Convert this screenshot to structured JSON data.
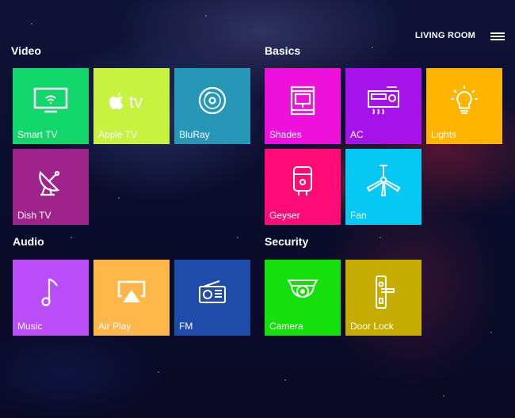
{
  "header": {
    "room_label": "LIVING ROOM",
    "menu_icon": "hamburger-menu-icon"
  },
  "sections": {
    "video": {
      "title": "Video",
      "tiles": [
        {
          "label": "Smart TV",
          "icon": "smart-tv-icon",
          "color": "#12d76a"
        },
        {
          "label": "Apple TV",
          "icon": "apple-tv-icon",
          "color": "#c7f23f"
        },
        {
          "label": "BluRay",
          "icon": "bluray-disc-icon",
          "color": "#2797b8"
        },
        {
          "label": "Dish TV",
          "icon": "satellite-dish-icon",
          "color": "#a0228b"
        }
      ]
    },
    "basics": {
      "title": "Basics",
      "tiles": [
        {
          "label": "Shades",
          "icon": "window-shades-icon",
          "color": "#ee11dc"
        },
        {
          "label": "AC",
          "icon": "air-conditioner-icon",
          "color": "#a512ea"
        },
        {
          "label": "Lights",
          "icon": "light-bulb-icon",
          "color": "#ffb400"
        },
        {
          "label": "Geyser",
          "icon": "water-heater-icon",
          "color": "#ff0c78"
        },
        {
          "label": "Fan",
          "icon": "ceiling-fan-icon",
          "color": "#05c8f5"
        }
      ]
    },
    "audio": {
      "title": "Audio",
      "tiles": [
        {
          "label": "Music",
          "icon": "music-note-icon",
          "color": "#bb4df8"
        },
        {
          "label": "Air Play",
          "icon": "airplay-icon",
          "color": "#ffb74a"
        },
        {
          "label": "FM",
          "icon": "radio-icon",
          "color": "#1f4bab"
        }
      ]
    },
    "security": {
      "title": "Security",
      "tiles": [
        {
          "label": "Camera",
          "icon": "security-camera-icon",
          "color": "#16e00b"
        },
        {
          "label": "Door Lock",
          "icon": "door-lock-icon",
          "color": "#c6ab00"
        }
      ]
    }
  }
}
